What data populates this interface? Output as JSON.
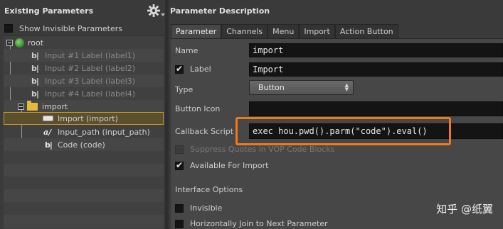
{
  "left_panel": {
    "title": "Existing Parameters",
    "show_invisible_label": "Show Invisible Parameters",
    "tree": {
      "root_label": "root",
      "items": [
        {
          "icon": "bl",
          "label": "Input #1 Label (label1)"
        },
        {
          "icon": "bl",
          "label": "Input #2 Label (label2)"
        },
        {
          "icon": "bl",
          "label": "Input #3 Label (label3)"
        },
        {
          "icon": "bl",
          "label": "Input #4 Label (label4)"
        }
      ],
      "folder_label": "import",
      "children": [
        {
          "icon": "button",
          "label": "Import (import)"
        },
        {
          "icon": "a/",
          "label": "Input_path (input_path)"
        },
        {
          "icon": "bl",
          "label": "Code (code)"
        }
      ]
    }
  },
  "right_panel": {
    "title": "Parameter Description",
    "tabs": [
      "Parameter",
      "Channels",
      "Menu",
      "Import",
      "Action Button"
    ],
    "name_label": "Name",
    "name_value": "import",
    "label_label": "Label",
    "label_value": "Import",
    "type_label": "Type",
    "type_value": "Button",
    "button_icon_label": "Button Icon",
    "callback_label": "Callback Script",
    "callback_value": "exec hou.pwd().parm(\"code\").eval()",
    "suppress_quotes_label": "Suppress Quotes in VOP Code Blocks",
    "available_import_label": "Available For Import",
    "interface_options_label": "Interface Options",
    "invisible_label": "Invisible",
    "join_next_label": "Horizontally Join to Next Parameter"
  },
  "watermark": "知乎 @纸翼",
  "colors": {
    "highlight": "#f07a1a",
    "selection_border": "#c79b2e"
  }
}
